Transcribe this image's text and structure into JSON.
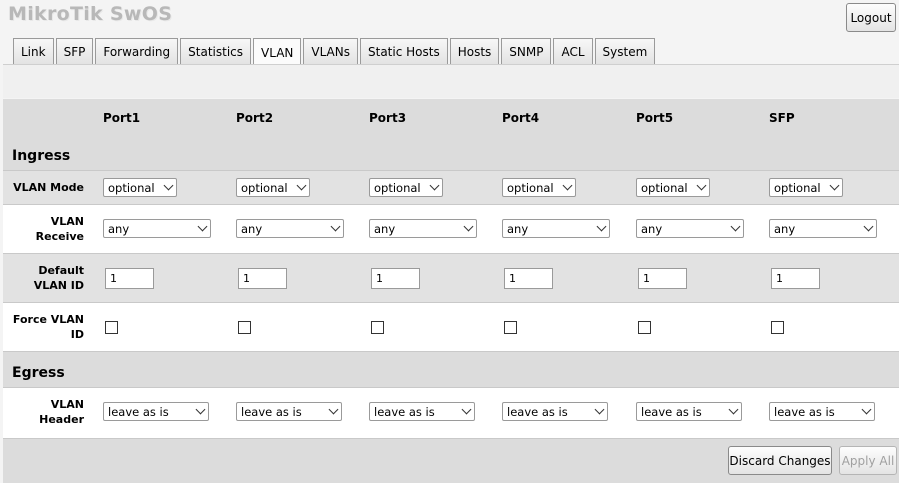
{
  "app": {
    "title": "MikroTik SwOS",
    "logout_label": "Logout"
  },
  "tabs": [
    {
      "label": "Link"
    },
    {
      "label": "SFP"
    },
    {
      "label": "Forwarding"
    },
    {
      "label": "Statistics"
    },
    {
      "label": "VLAN",
      "active": true
    },
    {
      "label": "VLANs"
    },
    {
      "label": "Static Hosts"
    },
    {
      "label": "Hosts"
    },
    {
      "label": "SNMP"
    },
    {
      "label": "ACL"
    },
    {
      "label": "System"
    }
  ],
  "ports": [
    "Port1",
    "Port2",
    "Port3",
    "Port4",
    "Port5",
    "SFP"
  ],
  "ingress": {
    "title": "Ingress",
    "vlan_mode_label": "VLAN Mode",
    "vlan_receive_label_1": "VLAN",
    "vlan_receive_label_2": "Receive",
    "default_vlan_label_1": "Default",
    "default_vlan_label_2": "VLAN ID",
    "force_vlan_label_1": "Force VLAN",
    "force_vlan_label_2": "ID",
    "vlan_mode": [
      "optional",
      "optional",
      "optional",
      "optional",
      "optional",
      "optional"
    ],
    "vlan_receive": [
      "any",
      "any",
      "any",
      "any",
      "any",
      "any"
    ],
    "default_vlan_id": [
      "1",
      "1",
      "1",
      "1",
      "1",
      "1"
    ],
    "force_vlan_id": [
      false,
      false,
      false,
      false,
      false,
      false
    ]
  },
  "egress": {
    "title": "Egress",
    "vlan_header_label_1": "VLAN",
    "vlan_header_label_2": "Header",
    "vlan_header": [
      "leave as is",
      "leave as is",
      "leave as is",
      "leave as is",
      "leave as is",
      "leave as is"
    ]
  },
  "actions": {
    "discard_label": "Discard Changes",
    "apply_label": "Apply All"
  }
}
